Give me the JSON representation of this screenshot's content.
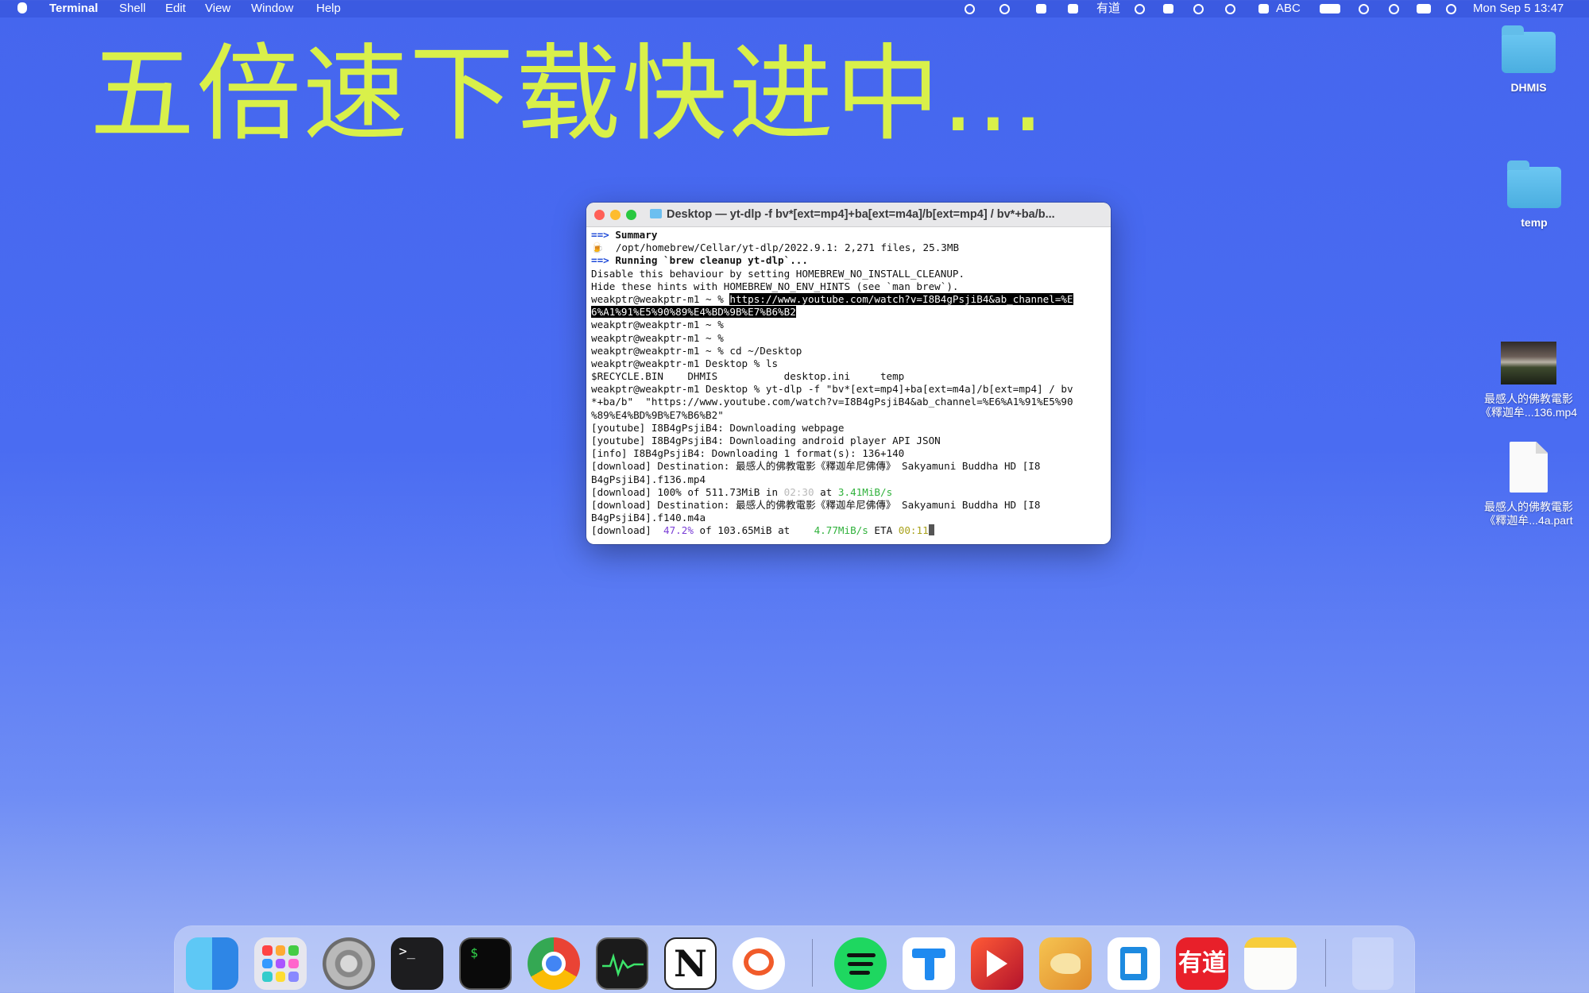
{
  "menubar": {
    "app_name": "Terminal",
    "menus": [
      "Shell",
      "Edit",
      "View",
      "Window",
      "Help"
    ],
    "tray": {
      "youdao": "有道",
      "input_source": "ABC",
      "datetime": "Mon Sep 5 13:47"
    }
  },
  "overlay_caption": "五倍速下载快进中...",
  "desktop": {
    "items": [
      {
        "label": "DHMIS",
        "icon": "folder-icon"
      },
      {
        "label": "temp",
        "icon": "folder-icon"
      },
      {
        "label": "最感人的佛教電影《釋迦牟...136.mp4",
        "icon": "video-thumbnail"
      },
      {
        "label": "最感人的佛教電影《釋迦牟...4a.part",
        "icon": "document-icon"
      }
    ],
    "video_label_lines": [
      "最感人的佛教電影",
      "《釋迦牟...136.mp4"
    ],
    "part_label_lines": [
      "最感人的佛教電影",
      "《釋迦牟...4a.part"
    ]
  },
  "terminal": {
    "title": "Desktop — yt-dlp -f bv*[ext=mp4]+ba[ext=m4a]/b[ext=mp4] / bv*+ba/b...",
    "lines": {
      "l01_arrow": "==>",
      "l01_text": " Summary",
      "l02_text": "🍺  /opt/homebrew/Cellar/yt-dlp/2022.9.1: 2,271 files, 25.3MB",
      "l03_arrow": "==>",
      "l03_text": " Running `brew cleanup yt-dlp`...",
      "l04_text": "Disable this behaviour by setting HOMEBREW_NO_INSTALL_CLEANUP.",
      "l05_text": "Hide these hints with HOMEBREW_NO_ENV_HINTS (see `man brew`).",
      "l06_prompt": "weakptr@weakptr-m1 ~ % ",
      "l06_sel": "https://www.youtube.com/watch?v=I8B4gPsjiB4&ab_channel=%E",
      "l07_sel": "6%A1%91%E5%90%89%E4%BD%9B%E7%B6%B2",
      "l08_text": "weakptr@weakptr-m1 ~ %",
      "l09_text": "weakptr@weakptr-m1 ~ %",
      "l10_text": "weakptr@weakptr-m1 ~ % cd ~/Desktop",
      "l11_text": "weakptr@weakptr-m1 Desktop % ls",
      "l12_text": "$RECYCLE.BIN    DHMIS           desktop.ini     temp",
      "l13_text": "weakptr@weakptr-m1 Desktop % yt-dlp -f \"bv*[ext=mp4]+ba[ext=m4a]/b[ext=mp4] / bv",
      "l14_text": "*+ba/b\"  \"https://www.youtube.com/watch?v=I8B4gPsjiB4&ab_channel=%E6%A1%91%E5%90",
      "l15_text": "%89%E4%BD%9B%E7%B6%B2\"",
      "l16_text": "[youtube] I8B4gPsjiB4: Downloading webpage",
      "l17_text": "[youtube] I8B4gPsjiB4: Downloading android player API JSON",
      "l18_text": "[info] I8B4gPsjiB4: Downloading 1 format(s): 136+140",
      "l19_text": "[download] Destination: 最感人的佛教電影《釋迦牟尼佛傳》 Sakyamuni Buddha HD [I8",
      "l20_text": "B4gPsjiB4].f136.mp4",
      "l21_pre": "[download] 100% of 511.73MiB in ",
      "l21_time": "02:30",
      "l21_mid": " at ",
      "l21_speed": "3.41MiB/s",
      "l22_text": "[download] Destination: 最感人的佛教電影《釋迦牟尼佛傳》 Sakyamuni Buddha HD [I8",
      "l23_text": "B4gPsjiB4].f140.m4a",
      "l24_pre": "[download]  ",
      "l24_pct": "47.2%",
      "l24_mid": " of 103.65MiB at    ",
      "l24_speed": "4.77MiB/s",
      "l24_eta_label": " ETA ",
      "l24_eta": "00:11"
    }
  },
  "dock": {
    "apps": [
      "Finder",
      "Launchpad",
      "System Preferences",
      "Terminal",
      "iTerm",
      "Google Chrome",
      "Activity Monitor",
      "Notion",
      "Messages",
      "Spotify",
      "Pin",
      "Infuse",
      "TablePlus",
      "Visual Studio Code",
      "有道",
      "Notes",
      "Trash"
    ],
    "youdao_label": "有道",
    "notion_label": "N",
    "terminal_glyph": ">_",
    "iterm_glyph": "$"
  }
}
